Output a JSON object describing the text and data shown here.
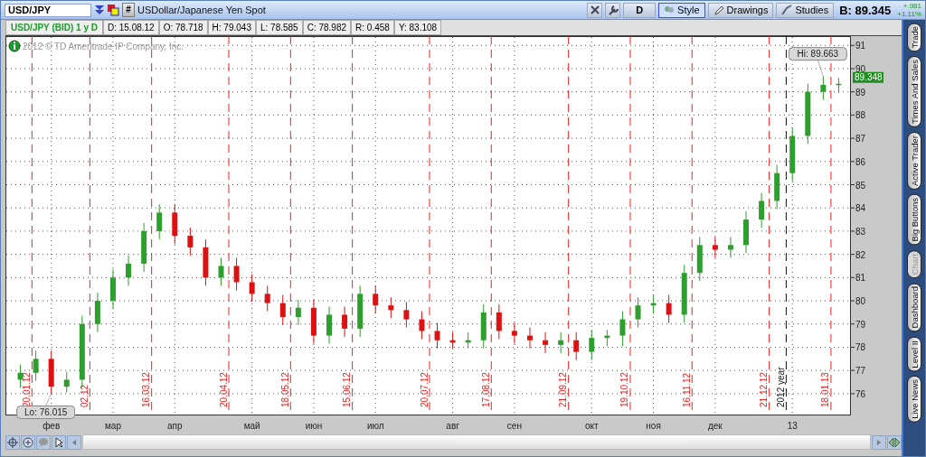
{
  "toolbar": {
    "symbol": "USD/JPY",
    "grid_button": "#",
    "description": "USDollar/Japanese Yen Spot",
    "buttons": [
      {
        "label": "D",
        "kind": "plain",
        "selected": false
      },
      {
        "label": "Style",
        "kind": "style",
        "selected": true
      },
      {
        "label": "Drawings",
        "kind": "pencil",
        "selected": false
      },
      {
        "label": "Studies",
        "kind": "studies",
        "selected": false
      }
    ],
    "bid": "B: 89.345",
    "change": "+.981",
    "change_pct": "+1.11%"
  },
  "info_bar": {
    "title": "USD/JPY (BID) 1 y D",
    "fields": [
      "D: 15.08.12",
      "O: 78.718",
      "H: 79.043",
      "L: 78.585",
      "C: 78.982",
      "R: 0.458",
      "Y: 83.108"
    ]
  },
  "copyright": "2012 © TD Ameritrade IP Company, Inc.",
  "chart": {
    "chart_data": {
      "type": "candlestick",
      "ylim": [
        75.1,
        91.4
      ],
      "categories": [
        null,
        null,
        "фев",
        null,
        null,
        null,
        "мар",
        null,
        null,
        null,
        "апр",
        null,
        null,
        null,
        null,
        "май",
        null,
        null,
        null,
        "июн",
        null,
        null,
        null,
        "июл",
        null,
        null,
        null,
        null,
        "авг",
        null,
        null,
        null,
        "сен",
        null,
        null,
        null,
        null,
        "окт",
        null,
        null,
        null,
        "ноя",
        null,
        null,
        null,
        "дек",
        null,
        null,
        null,
        null,
        "13",
        null,
        null,
        null
      ],
      "ohlc": [
        [
          76.6,
          77.25,
          76.25,
          76.9
        ],
        [
          76.9,
          77.85,
          76.55,
          77.5
        ],
        [
          77.5,
          77.85,
          76.015,
          76.3
        ],
        [
          76.3,
          76.95,
          76.05,
          76.6
        ],
        [
          76.6,
          79.35,
          76.25,
          79.0
        ],
        [
          79.0,
          80.35,
          78.65,
          80.0
        ],
        [
          80.0,
          81.35,
          79.65,
          81.0
        ],
        [
          81.0,
          81.95,
          80.65,
          81.6
        ],
        [
          81.6,
          83.35,
          81.25,
          83.0
        ],
        [
          83.0,
          84.15,
          82.65,
          83.8
        ],
        [
          83.8,
          84.15,
          82.45,
          82.8
        ],
        [
          82.8,
          83.15,
          81.95,
          82.3
        ],
        [
          82.3,
          82.65,
          80.65,
          81.0
        ],
        [
          81.0,
          81.85,
          80.65,
          81.5
        ],
        [
          81.5,
          81.85,
          80.45,
          80.8
        ],
        [
          80.8,
          81.15,
          79.95,
          80.3
        ],
        [
          80.3,
          80.65,
          79.55,
          79.9
        ],
        [
          79.9,
          80.25,
          78.95,
          79.3
        ],
        [
          79.3,
          80.05,
          78.95,
          79.7
        ],
        [
          79.7,
          80.05,
          78.15,
          78.5
        ],
        [
          78.5,
          79.75,
          78.15,
          79.4
        ],
        [
          79.4,
          79.75,
          78.45,
          78.8
        ],
        [
          78.8,
          80.65,
          78.45,
          80.3
        ],
        [
          80.3,
          80.65,
          79.45,
          79.8
        ],
        [
          79.8,
          80.15,
          79.25,
          79.6
        ],
        [
          79.6,
          79.95,
          78.85,
          79.2
        ],
        [
          79.2,
          79.55,
          78.35,
          78.7
        ],
        [
          78.7,
          79.05,
          77.95,
          78.3
        ],
        [
          78.3,
          78.65,
          77.95,
          78.2
        ],
        [
          78.2,
          78.65,
          77.95,
          78.3
        ],
        [
          78.3,
          79.85,
          77.95,
          79.5
        ],
        [
          79.5,
          79.85,
          78.35,
          78.7
        ],
        [
          78.7,
          79.05,
          78.15,
          78.5
        ],
        [
          78.5,
          78.85,
          77.95,
          78.3
        ],
        [
          78.3,
          78.65,
          77.75,
          78.1
        ],
        [
          78.1,
          78.65,
          77.75,
          78.3
        ],
        [
          78.3,
          78.65,
          77.45,
          77.8
        ],
        [
          77.8,
          78.75,
          77.45,
          78.4
        ],
        [
          78.4,
          78.75,
          78.05,
          78.5
        ],
        [
          78.5,
          79.55,
          78.05,
          79.2
        ],
        [
          79.2,
          80.15,
          78.85,
          79.8
        ],
        [
          79.8,
          80.25,
          79.45,
          79.9
        ],
        [
          79.9,
          80.25,
          79.05,
          79.4
        ],
        [
          79.4,
          81.55,
          79.05,
          81.2
        ],
        [
          81.2,
          82.75,
          80.85,
          82.4
        ],
        [
          82.4,
          82.75,
          81.85,
          82.2
        ],
        [
          82.2,
          82.75,
          81.85,
          82.4
        ],
        [
          82.4,
          83.85,
          82.05,
          83.5
        ],
        [
          83.5,
          84.65,
          83.15,
          84.3
        ],
        [
          84.3,
          85.85,
          83.95,
          85.5
        ],
        [
          85.5,
          87.45,
          85.15,
          87.1
        ],
        [
          87.1,
          89.35,
          86.75,
          89.0
        ],
        [
          89.0,
          89.663,
          88.65,
          89.3
        ],
        [
          89.3,
          89.6,
          88.95,
          89.348
        ]
      ],
      "yticks": [
        76,
        77,
        78,
        79,
        80,
        81,
        82,
        83,
        84,
        85,
        86,
        87,
        88,
        89,
        90,
        91
      ],
      "grid": true
    },
    "date_lines": [
      {
        "kind": "expiry",
        "label": "20.01.12"
      },
      {
        "kind": "expiry",
        "label": "02.12"
      },
      {
        "kind": "expiry",
        "label": "16.03.12"
      },
      {
        "kind": "expiry",
        "label": "20.04.12"
      },
      {
        "kind": "expiry",
        "label": "18.05.12"
      },
      {
        "kind": "expiry",
        "label": "15.06.12"
      },
      {
        "kind": "expiry",
        "label": "20.07.12"
      },
      {
        "kind": "expiry",
        "label": "17.08.12"
      },
      {
        "kind": "expiry",
        "label": "21.09.12"
      },
      {
        "kind": "expiry",
        "label": "19.10.12"
      },
      {
        "kind": "expiry",
        "label": "16.11.12"
      },
      {
        "kind": "expiry",
        "label": "21.12.12"
      },
      {
        "kind": "year",
        "label": "2012 year"
      },
      {
        "kind": "expiry",
        "label": "18.01.13"
      }
    ],
    "callouts": [
      {
        "kind": "high",
        "label": "Hi: 89.663"
      },
      {
        "kind": "low",
        "label": "Lo: 76.015"
      },
      {
        "kind": "last",
        "label": "89.348"
      }
    ]
  },
  "sidebar": {
    "tabs": [
      {
        "label": "Trade",
        "selected": false
      },
      {
        "label": "Times And Sales",
        "selected": false
      },
      {
        "label": "Active Trader",
        "selected": false
      },
      {
        "label": "Big Buttons",
        "selected": false
      },
      {
        "label": "Chart",
        "selected": true
      },
      {
        "label": "Dashboard",
        "selected": false
      },
      {
        "label": "Level II",
        "selected": false
      },
      {
        "label": "Live News",
        "selected": false
      }
    ]
  }
}
